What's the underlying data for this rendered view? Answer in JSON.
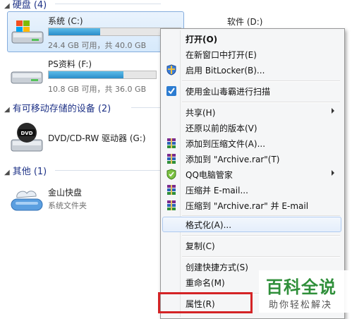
{
  "sections": {
    "hard_disks": "硬盘 (4)",
    "removable": "有可移动存储的设备 (2)",
    "other": "其他 (1)"
  },
  "drives": {
    "c": {
      "name": "系统 (C:)",
      "free": "24.4 GB 可用，共 40.0 GB",
      "used_fraction": 0.39
    },
    "d": {
      "name": "软件 (D:)"
    },
    "f": {
      "name": "PS资料 (F:)",
      "free": "10.8 GB 可用，共 36.0 GB",
      "used_fraction": 0.7
    },
    "g": {
      "name": "DVD/CD-RW 驱动器 (G:)",
      "icon_label": "DVD"
    },
    "kuaipan": {
      "name": "金山快盘",
      "sub": "系统文件夹"
    }
  },
  "context_menu": {
    "open": "打开(O)",
    "open_new_window": "在新窗口中打开(E)",
    "bitlocker": "启用 BitLocker(B)...",
    "scan": "使用金山毒霸进行扫描",
    "share": "共享(H)",
    "restore": "还原以前的版本(V)",
    "add_archive": "添加到压缩文件(A)...",
    "add_archive_rar": "添加到 \"Archive.rar\"(T)",
    "qq_manager": "QQ电脑管家",
    "compress_email": "压缩并 E-mail...",
    "compress_rar_email": "压缩到 \"Archive.rar\" 并 E-mail",
    "format": "格式化(A)...",
    "copy": "复制(C)",
    "create_shortcut": "创建快捷方式(S)",
    "rename": "重命名(M)",
    "properties": "属性(R)"
  },
  "watermark": {
    "title": "百科全说",
    "subtitle": "助你轻松解决"
  },
  "colors": {
    "accent": "#1e3287",
    "highlight": "#d42426",
    "brand": "#2f8f3a",
    "bar": "#2a8dc9"
  }
}
